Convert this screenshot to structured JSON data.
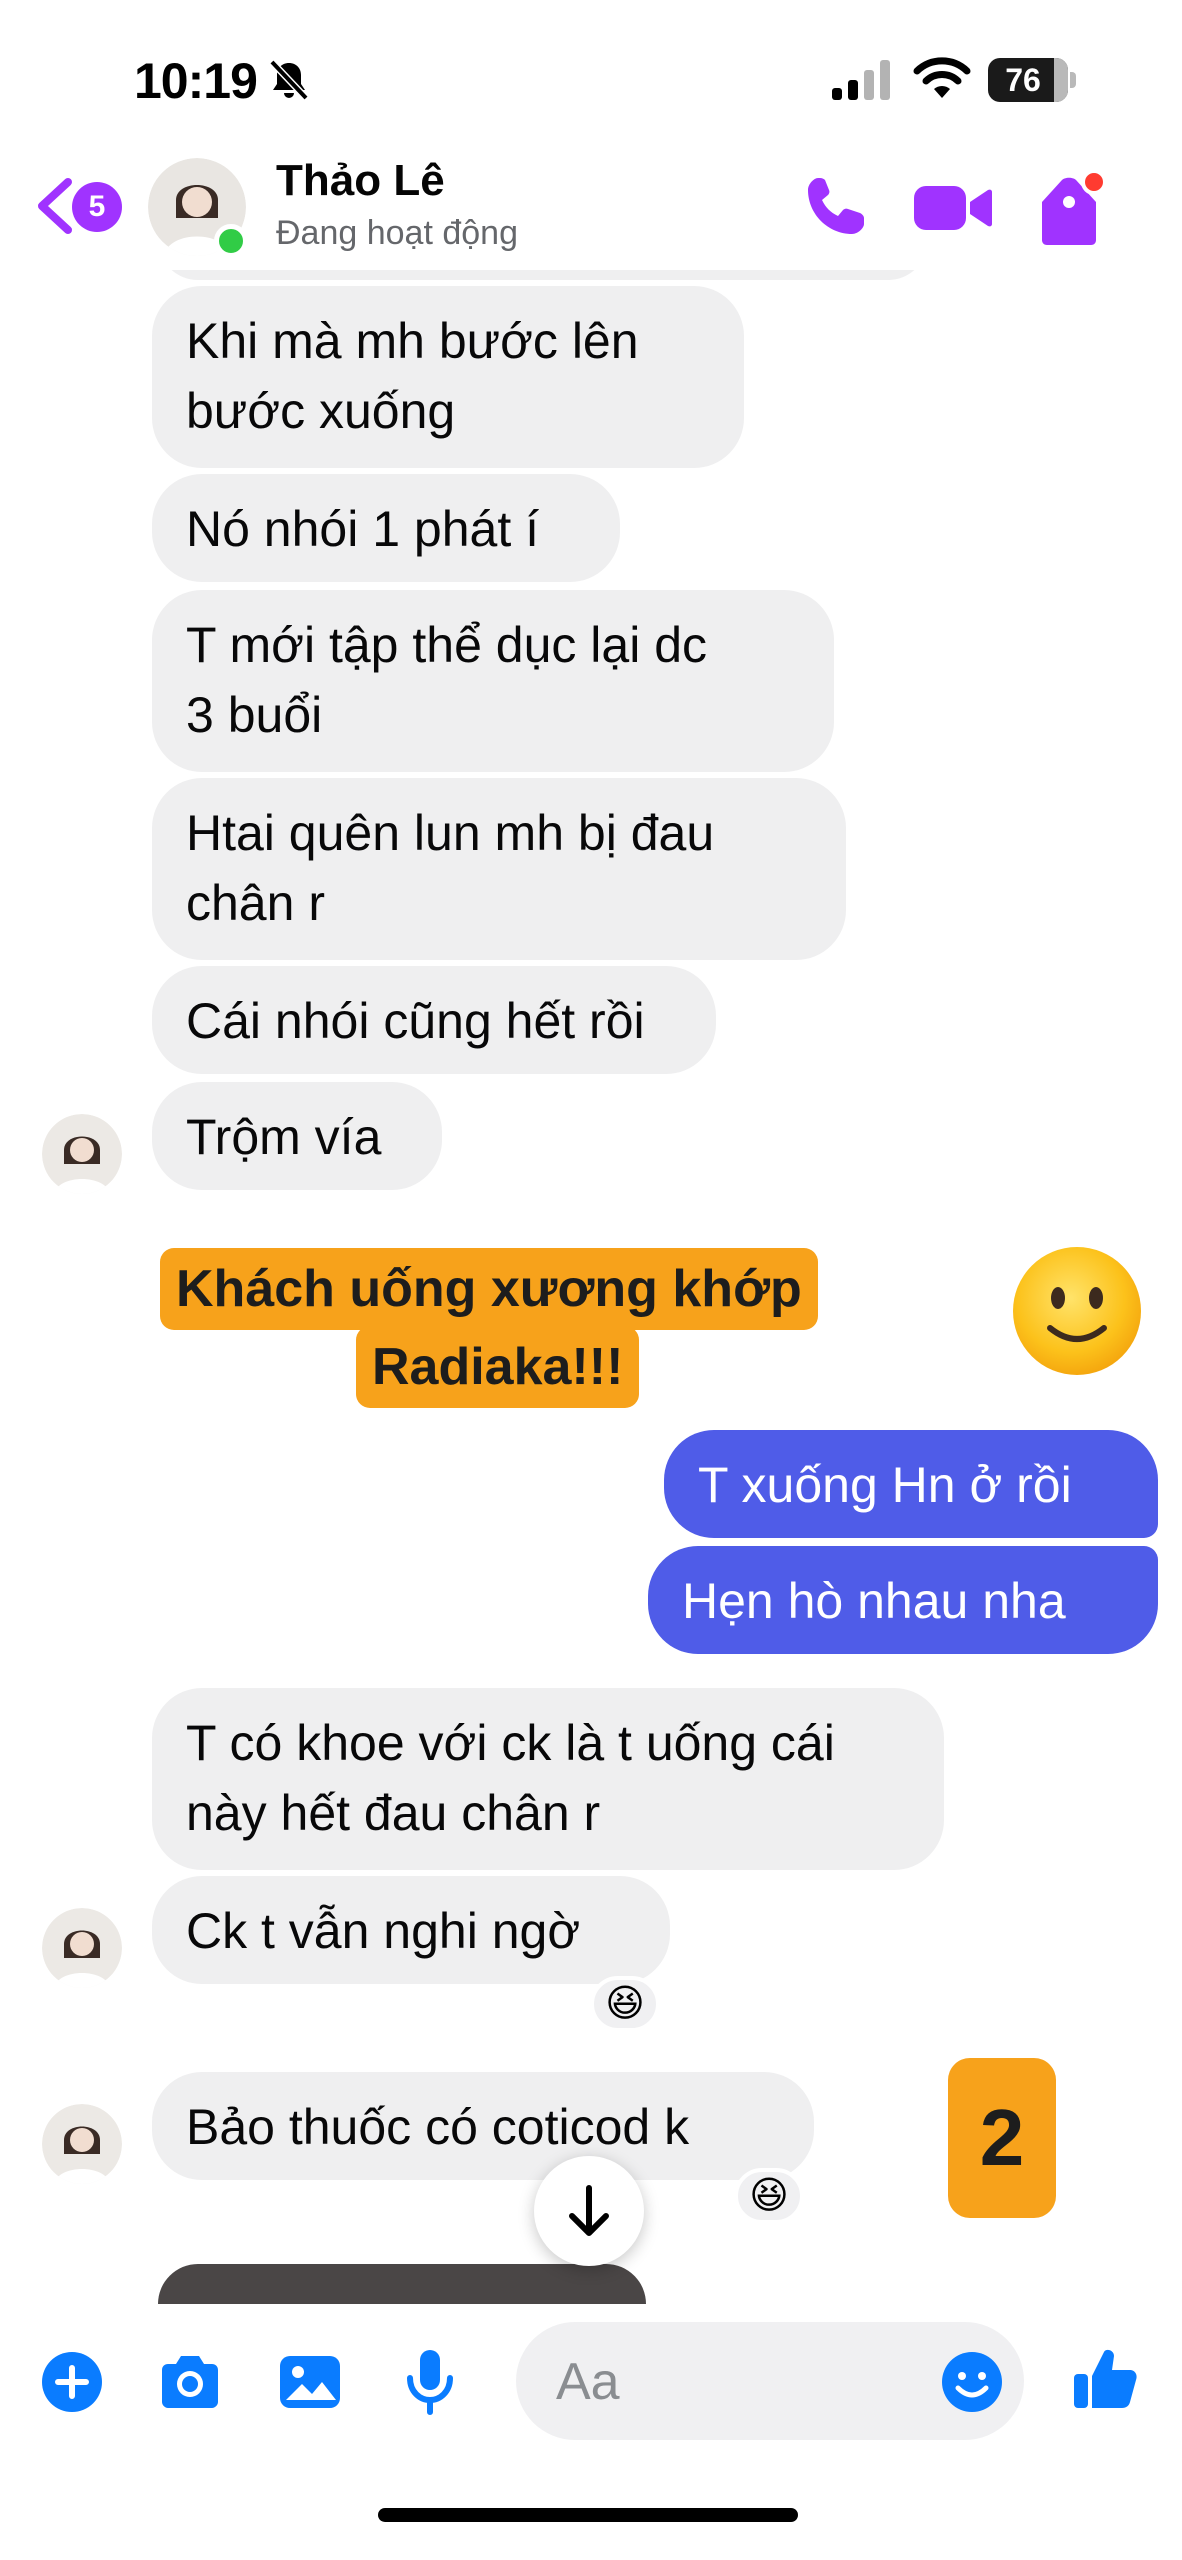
{
  "status_bar": {
    "time": "10:19",
    "battery": "76",
    "icons": [
      "bell-slash-icon",
      "cellular-signal-icon",
      "wifi-icon",
      "battery-icon"
    ]
  },
  "header": {
    "back_badge": "5",
    "contact_name": "Thảo Lê",
    "contact_status": "Đang hoạt động",
    "icons": [
      "back-chevron-icon",
      "phone-icon",
      "video-camera-icon",
      "tag-icon"
    ],
    "accent_color": "#a033ff"
  },
  "messages": {
    "m1": "Khi mà mh bước lên",
    "m1b": "bước xuống",
    "m2": "Nó nhói 1 phát í",
    "m3": "T mới tập thể dục lại dc",
    "m3b": "3 buổi",
    "m4": "Htai quên lun mh bị đau",
    "m4b": "chân r",
    "m5": "Cái nhói cũng hết rồi",
    "m6": "Trộm vía",
    "o1": "T xuống Hn ở rồi",
    "o2": "Hẹn hò nhau nha",
    "m7": "T có khoe với ck là t uống cái",
    "m7b": "này hết đau chân r",
    "m8": "Ck t vẫn nghi ngờ",
    "m9": "Bảo thuốc có coticod k"
  },
  "reactions": {
    "r1": "😆",
    "r2": "😆"
  },
  "overlay": {
    "promo_line1": "Khách uống xương khớp",
    "promo_line2": "Radiaka!!!",
    "number_badge": "2",
    "emoji": "slightly-smiling-face"
  },
  "composer": {
    "placeholder": "Aa",
    "icons": [
      "plus-icon",
      "camera-icon",
      "image-icon",
      "microphone-icon",
      "emoji-icon",
      "thumbs-up-icon"
    ]
  },
  "colors": {
    "incoming_bubble": "#efeff0",
    "outgoing_bubble": "#4f5ce8",
    "promo_orange": "#f7a21b",
    "online_green": "#31cc46"
  }
}
